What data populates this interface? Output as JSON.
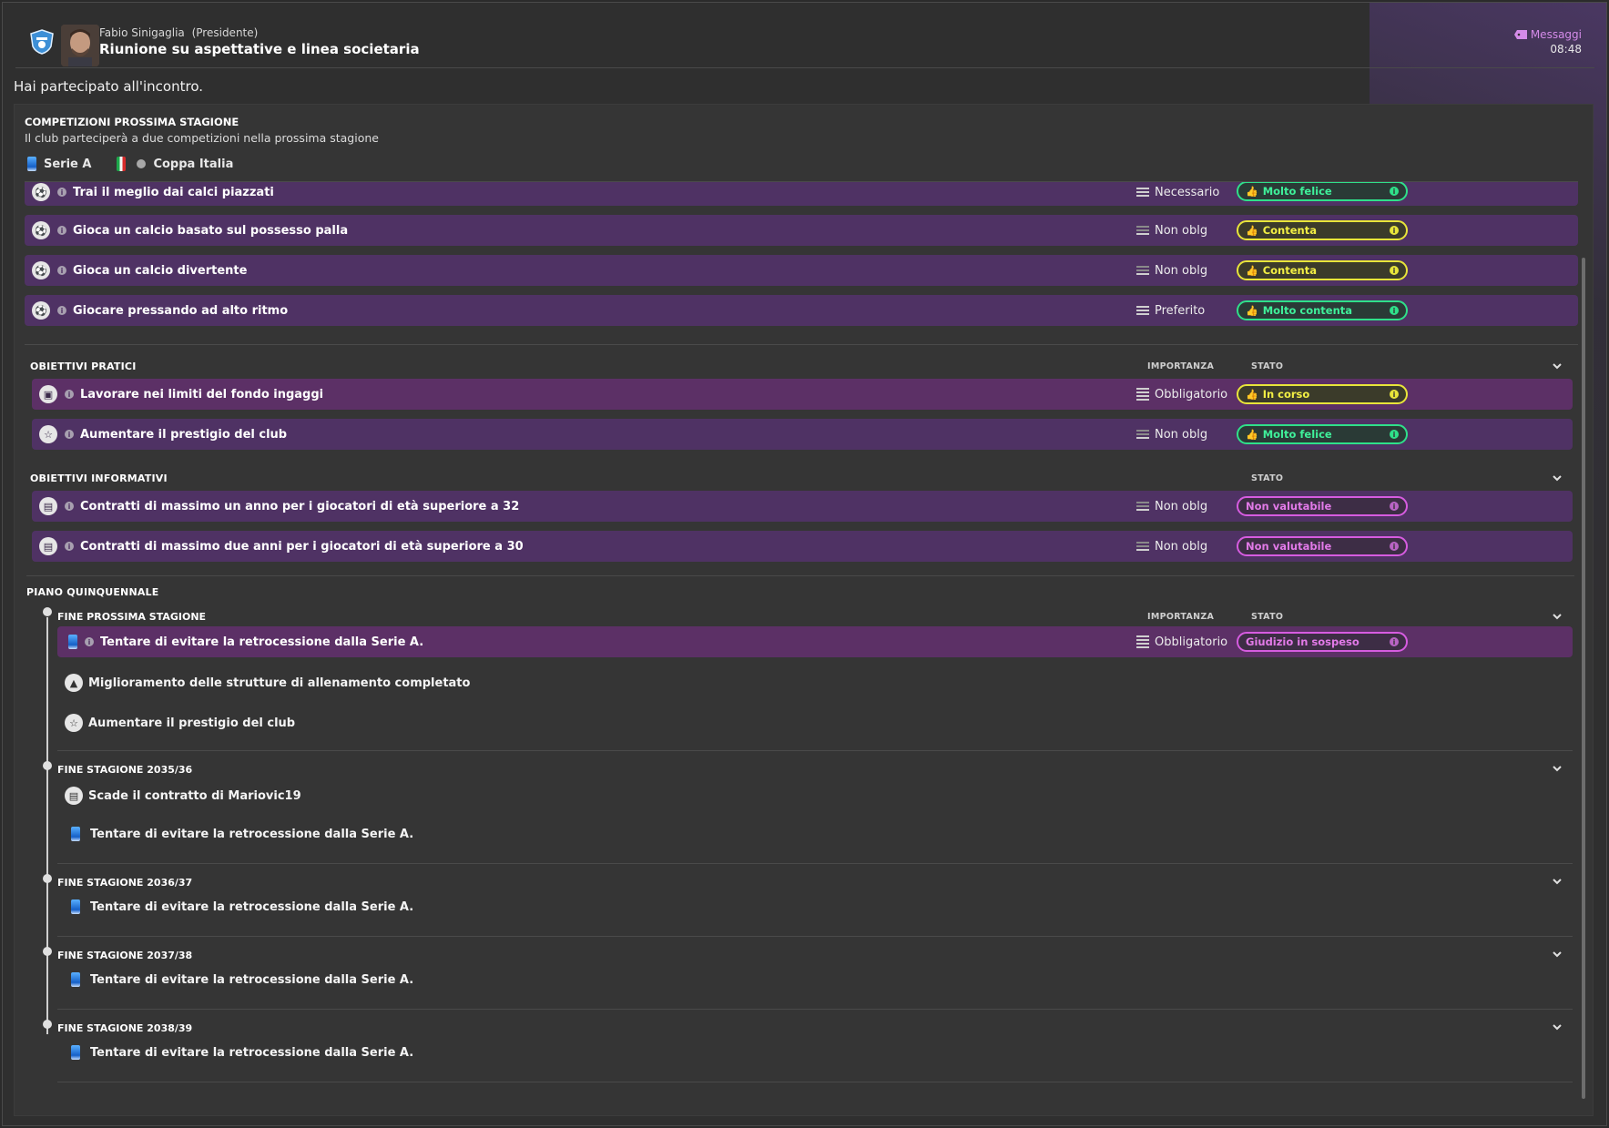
{
  "header": {
    "sender_name": "Fabio Sinigaglia",
    "sender_role": "(Presidente)",
    "subject": "Riunione su aspettative e linea societaria",
    "messages_label": "Messaggi",
    "time": "08:48",
    "badge_icon": "club-crest-icon",
    "avatar": "president-avatar"
  },
  "intro": "Hai partecipato all'incontro.",
  "competitions": {
    "title": "COMPETIZIONI PROSSIMA STAGIONE",
    "description": "Il club parteciperà a due competizioni nella prossima stagione",
    "items": [
      {
        "label": "Serie A",
        "icon": "serie-a-icon"
      },
      {
        "label": "Coppa Italia",
        "icon": "coppa-italia-icon"
      }
    ]
  },
  "style_rows": [
    {
      "label": "Trai il meglio dai calci piazzati",
      "importance": "Necessario",
      "status": "Molto felice",
      "status_color": "green"
    },
    {
      "label": "Gioca un calcio basato sul possesso palla",
      "importance": "Non oblg",
      "status": "Contenta",
      "status_color": "yellow"
    },
    {
      "label": "Gioca un calcio divertente",
      "importance": "Non oblg",
      "status": "Contenta",
      "status_color": "yellow"
    },
    {
      "label": "Giocare pressando ad alto ritmo",
      "importance": "Preferito",
      "status": "Molto contenta",
      "status_color": "green"
    }
  ],
  "practical": {
    "title": "OBIETTIVI PRATICI",
    "col_importance": "IMPORTANZA",
    "col_status": "STATO",
    "rows": [
      {
        "label": "Lavorare nei limiti del fondo ingaggi",
        "importance": "Obbligatorio",
        "status": "In corso",
        "status_color": "yellow"
      },
      {
        "label": "Aumentare il prestigio del club",
        "importance": "Non oblg",
        "status": "Molto felice",
        "status_color": "green"
      }
    ]
  },
  "informative": {
    "title": "OBIETTIVI INFORMATIVI",
    "col_status": "STATO",
    "rows": [
      {
        "label": "Contratti di massimo un anno per i giocatori di età superiore a 32",
        "importance": "Non oblg",
        "status": "Non valutabile",
        "status_color": "pink"
      },
      {
        "label": "Contratti di massimo due anni per i giocatori di età superiore a 30",
        "importance": "Non oblg",
        "status": "Non valutabile",
        "status_color": "pink"
      }
    ]
  },
  "five_year": {
    "title": "PIANO QUINQUENNALE",
    "col_importance": "IMPORTANZA",
    "col_status": "STATO",
    "next_season": {
      "title": "FINE PROSSIMA STAGIONE",
      "main_row": {
        "label": "Tentare di evitare la retrocessione dalla Serie A.",
        "importance": "Obbligatorio",
        "status": "Giudizio in sospeso",
        "status_color": "pink"
      },
      "items": [
        {
          "label": "Miglioramento delle strutture di allenamento completato",
          "icon": "training-cone-icon"
        },
        {
          "label": "Aumentare il prestigio del club",
          "icon": "star-icon"
        }
      ]
    },
    "seasons": [
      {
        "title": "FINE STAGIONE 2035/36",
        "items": [
          {
            "label": "Scade il contratto di Mariovic19",
            "icon": "contract-icon"
          },
          {
            "label": "Tentare di evitare la retrocessione dalla Serie A.",
            "icon": "serie-a-icon"
          }
        ]
      },
      {
        "title": "FINE STAGIONE 2036/37",
        "items": [
          {
            "label": "Tentare di evitare la retrocessione dalla Serie A.",
            "icon": "serie-a-icon"
          }
        ]
      },
      {
        "title": "FINE STAGIONE 2037/38",
        "items": [
          {
            "label": "Tentare di evitare la retrocessione dalla Serie A.",
            "icon": "serie-a-icon"
          }
        ]
      },
      {
        "title": "FINE STAGIONE 2038/39",
        "items": [
          {
            "label": "Tentare di evitare la retrocessione dalla Serie A.",
            "icon": "serie-a-icon"
          }
        ]
      }
    ]
  },
  "colors": {
    "row_purple": "#4f3264",
    "row_plum": "#5c3066",
    "status_green": "#2fe08a",
    "status_yellow": "#e8e53a",
    "status_pink": "#d65ce0",
    "accent_link": "#d48be8"
  }
}
